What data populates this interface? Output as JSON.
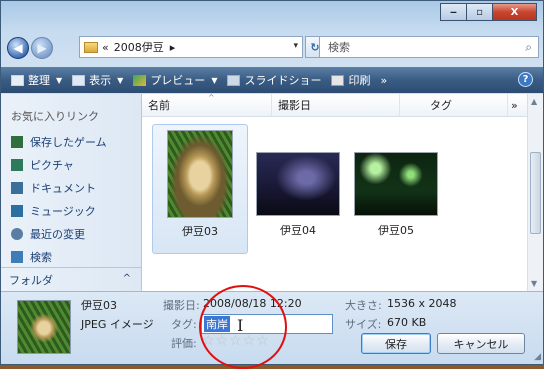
{
  "window": {
    "controls": {
      "minimize": "‒",
      "maximize": "▫",
      "close": "X"
    }
  },
  "address_bar": {
    "overflow_marker": "«",
    "path": "2008伊豆",
    "separator_arrow": "▸",
    "dropdown_arrow": "▾",
    "refresh_glyph": "↻",
    "search_placeholder": "検索"
  },
  "toolbar": {
    "organize": "整理",
    "views": "表示",
    "preview": "プレビュー",
    "slideshow": "スライドショー",
    "print": "印刷",
    "more": "»",
    "help": "?"
  },
  "nav_pane": {
    "header": "お気に入りリンク",
    "items": [
      {
        "label": "保存したゲーム",
        "icon": "saved-games-icon",
        "color": "#2f6f3e"
      },
      {
        "label": "ピクチャ",
        "icon": "pictures-icon",
        "color": "#2e7a5a"
      },
      {
        "label": "ドキュメント",
        "icon": "documents-icon",
        "color": "#3a6f9a"
      },
      {
        "label": "ミュージック",
        "icon": "music-icon",
        "color": "#2c6fa3"
      },
      {
        "label": "最近の変更",
        "icon": "recent-changes-icon",
        "color": "#5a7da3"
      },
      {
        "label": "検索",
        "icon": "search-folder-icon",
        "color": "#3d7db8"
      }
    ],
    "folders_label": "フォルダ",
    "folders_chevron": "^"
  },
  "columns": {
    "name": "名前",
    "date": "撮影日",
    "tag": "タグ",
    "more": "»",
    "sort_indicator": "^"
  },
  "files": [
    {
      "name": "伊豆03",
      "selected": true
    },
    {
      "name": "伊豆04",
      "selected": false
    },
    {
      "name": "伊豆05",
      "selected": false
    }
  ],
  "details": {
    "filename": "伊豆03",
    "filetype": "JPEG イメージ",
    "date_label": "撮影日:",
    "date_value": "2008/08/18 12:20",
    "tag_label": "タグ:",
    "tag_value": "南岸",
    "rating_label": "評価:",
    "rating_stars": "☆☆☆☆☆",
    "rating_value": 0,
    "size_label": "大きさ:",
    "size_value": "1536 x 2048",
    "filesize_label": "サイズ:",
    "filesize_value": "670 KB",
    "save_button": "保存",
    "cancel_button": "キャンセル"
  },
  "colors": {
    "annotation_circle": "#e01010",
    "toolbar": "#3a5c84",
    "selection": "#3a78d4"
  }
}
